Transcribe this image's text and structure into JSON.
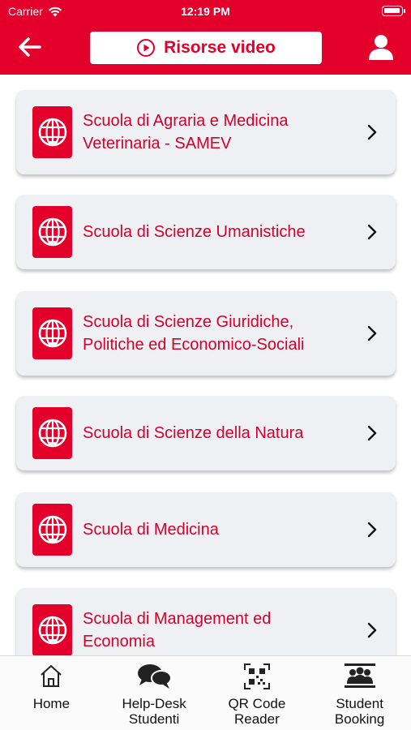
{
  "status": {
    "carrier": "Carrier",
    "time": "12:19 PM"
  },
  "header": {
    "title": "Risorse video"
  },
  "schools": [
    {
      "label": "Scuola di Agraria e Medicina Veterinaria - SAMEV"
    },
    {
      "label": "Scuola di Scienze Umanistiche"
    },
    {
      "label": "Scuola di Scienze Giuridiche, Politiche ed Economico-Sociali"
    },
    {
      "label": "Scuola di Scienze della Natura"
    },
    {
      "label": "Scuola di Medicina"
    },
    {
      "label": "Scuola di Management ed Economia"
    }
  ],
  "tabs": [
    {
      "line1": "Home",
      "line2": "",
      "icon": "home-icon"
    },
    {
      "line1": "Help-Desk",
      "line2": "Studenti",
      "icon": "chat-bubbles-icon"
    },
    {
      "line1": "QR Code",
      "line2": "Reader",
      "icon": "qr-code-icon"
    },
    {
      "line1": "Student",
      "line2": "Booking",
      "icon": "group-icon"
    }
  ],
  "colors": {
    "brand": "#e3002b",
    "card": "#eff0f4",
    "text_accent": "#d5002a"
  }
}
